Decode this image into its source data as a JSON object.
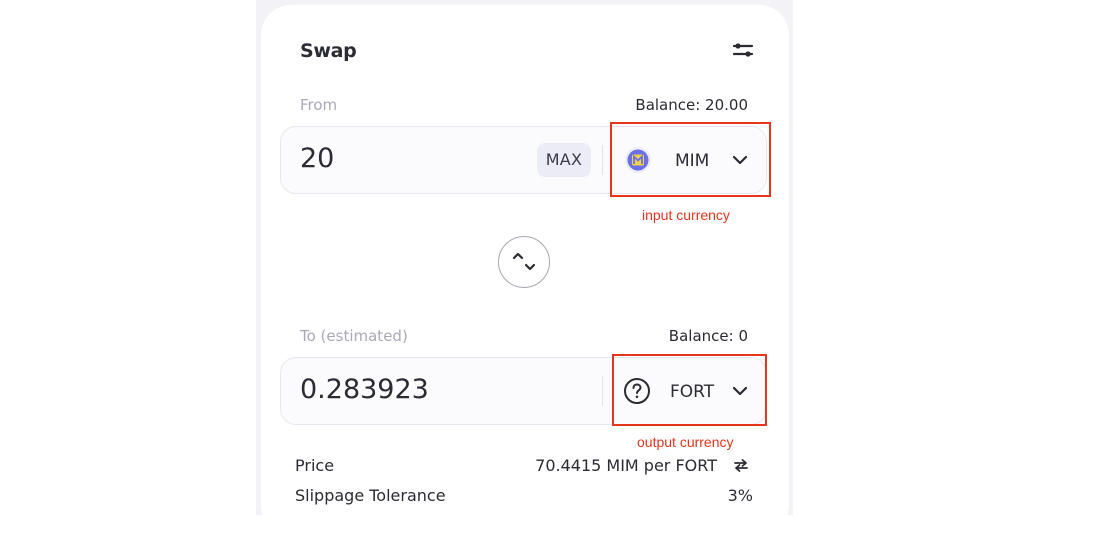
{
  "swap": {
    "title": "Swap",
    "from": {
      "label": "From",
      "balance": "Balance: 20.00",
      "amount": "20",
      "max_label": "MAX",
      "token": "MIM",
      "annotation": "input currency"
    },
    "to": {
      "label": "To (estimated)",
      "balance": "Balance: 0",
      "amount": "0.283923",
      "token": "FORT",
      "annotation": "output currency"
    },
    "details": {
      "price_label": "Price",
      "price_value": "70.4415 MIM per FORT",
      "slippage_label": "Slippage Tolerance",
      "slippage_value": "3%"
    }
  },
  "colors": {
    "annotation_red": "#e8341c",
    "mim_token": "#6a6ee8",
    "mim_token_accent": "#f2d24a"
  },
  "icons": {
    "settings": "sliders-icon",
    "swap": "swap-direction-icon",
    "from_token": "mim-token-icon",
    "to_token": "unknown-token-icon",
    "chevron": "chevron-down-icon",
    "price_toggle": "refresh-icon"
  }
}
